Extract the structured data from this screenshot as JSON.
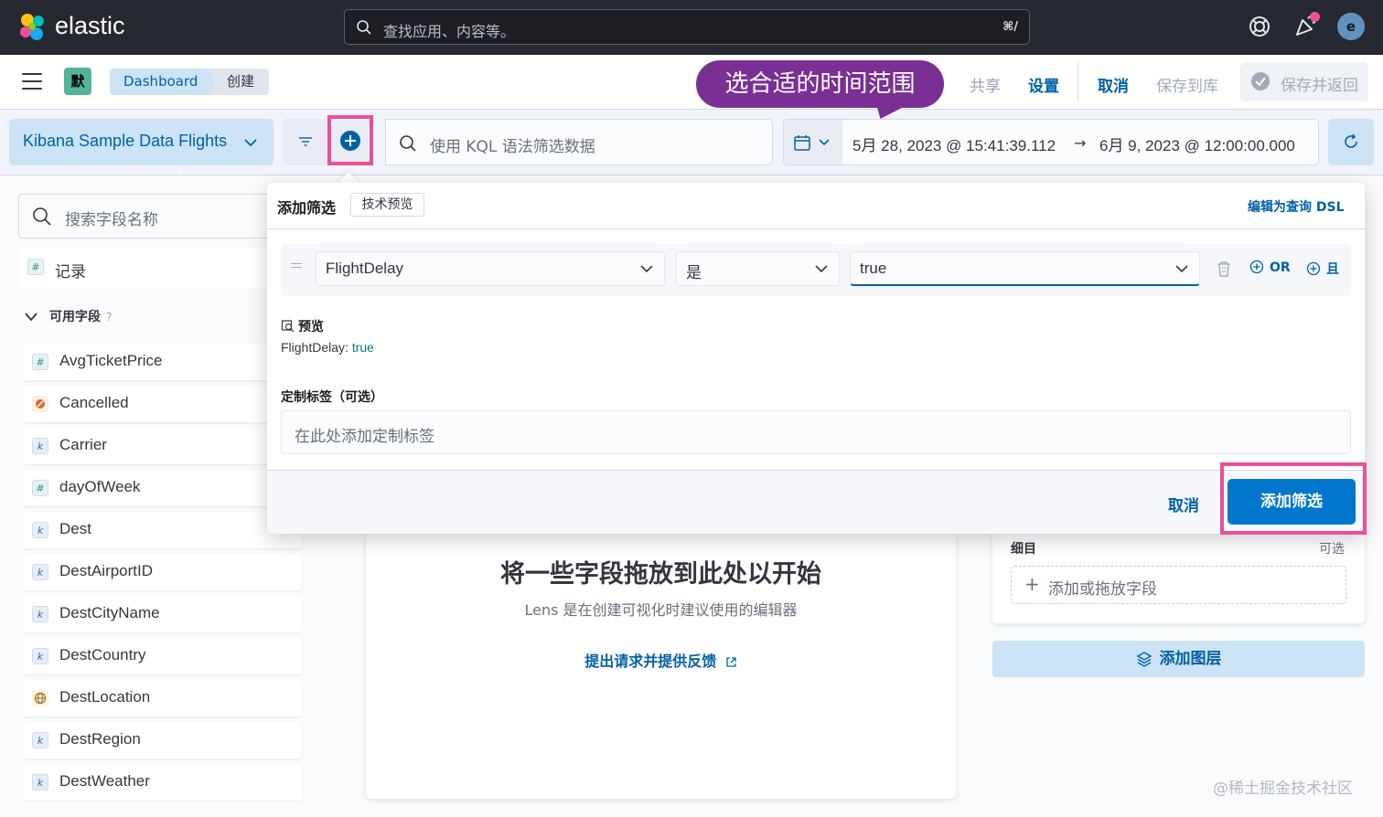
{
  "topbar": {
    "brand": "elastic",
    "search_placeholder": "查找应用、内容等。",
    "search_shortcut": "⌘/",
    "avatar_letter": "e"
  },
  "subbar": {
    "space_badge": "默",
    "breadcrumbs": [
      "Dashboard",
      "创建"
    ],
    "callout": "选合适的时间范围",
    "share": "共享",
    "settings": "设置",
    "cancel": "取消",
    "save_to_library": "保存到库",
    "save_and_return": "保存并返回"
  },
  "querybar": {
    "data_view": "Kibana Sample Data Flights",
    "kql_placeholder": "使用 KQL 语法筛选数据",
    "date_start": "5月 28, 2023 @ 15:41:39.112",
    "date_arrow": "→",
    "date_end": "6月 9, 2023 @ 12:00:00.000"
  },
  "sidebar": {
    "search_placeholder": "搜索字段名称",
    "records": "记录",
    "available_fields": "可用字段",
    "help_mark": "?",
    "fields": [
      {
        "name": "AvgTicketPrice",
        "type": "number",
        "token": "#"
      },
      {
        "name": "Cancelled",
        "type": "boolean",
        "token": ""
      },
      {
        "name": "Carrier",
        "type": "keyword",
        "token": "k"
      },
      {
        "name": "dayOfWeek",
        "type": "number",
        "token": "#"
      },
      {
        "name": "Dest",
        "type": "keyword",
        "token": "k"
      },
      {
        "name": "DestAirportID",
        "type": "keyword",
        "token": "k"
      },
      {
        "name": "DestCityName",
        "type": "keyword",
        "token": "k"
      },
      {
        "name": "DestCountry",
        "type": "keyword",
        "token": "k"
      },
      {
        "name": "DestLocation",
        "type": "geo",
        "token": ""
      },
      {
        "name": "DestRegion",
        "type": "keyword",
        "token": "k"
      },
      {
        "name": "DestWeather",
        "type": "keyword",
        "token": "k"
      }
    ]
  },
  "workspace": {
    "title": "将一些字段拖放到此处以开始",
    "subtitle": "Lens 是在创建可视化时建议使用的编辑器",
    "feedback_link": "提出请求并提供反馈"
  },
  "config_panel": {
    "breakdown_label": "细目",
    "optional": "可选",
    "drop_hint": "添加或拖放字段",
    "add_layer": "添加图层"
  },
  "filter_popover": {
    "title": "添加筛选",
    "badge": "技术预览",
    "edit_dsl": "编辑为查询 DSL",
    "field": "FlightDelay",
    "operator": "是",
    "value": "true",
    "or_label": "OR",
    "and_label": "且",
    "preview_heading": "预览",
    "preview_field": "FlightDelay: ",
    "preview_value": "true",
    "custom_label_heading": "定制标签（可选）",
    "custom_label_placeholder": "在此处添加定制标签",
    "cancel": "取消",
    "add": "添加筛选"
  },
  "watermark": "@稀土掘金技术社区",
  "colors": {
    "accent": "#0077cc",
    "highlight": "#ec4f99",
    "callout": "#7a2f95",
    "topbar": "#25282f"
  }
}
